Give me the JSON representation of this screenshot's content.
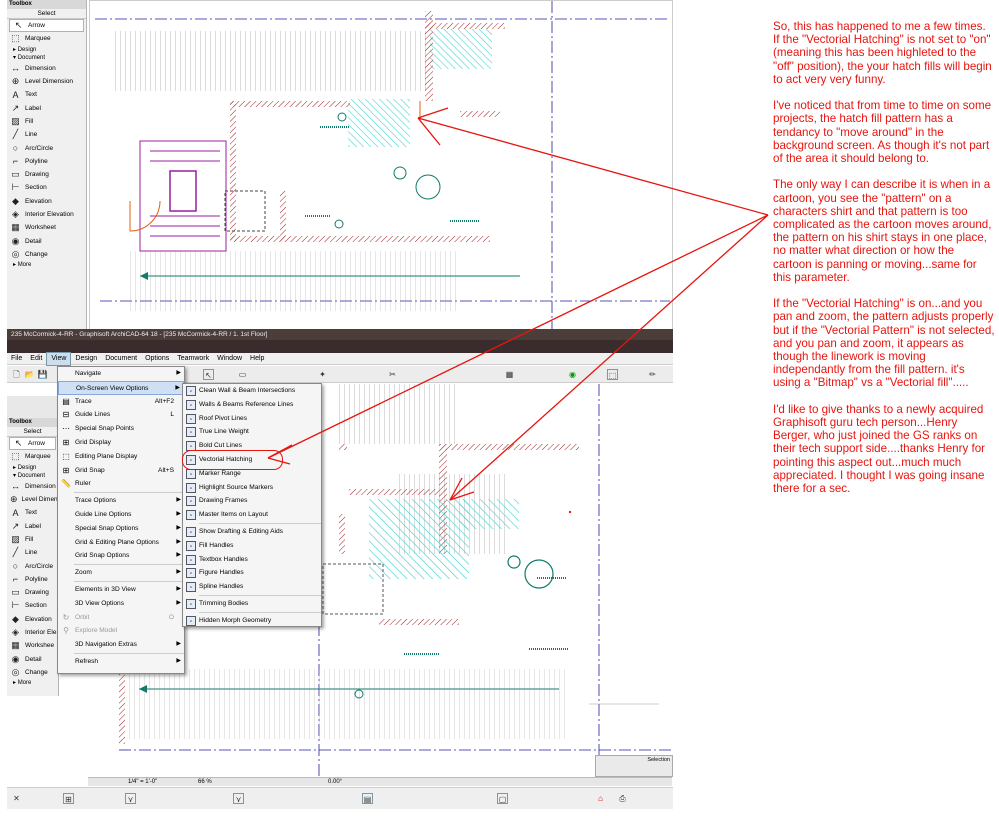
{
  "top_toolbox": {
    "title": "Toolbox",
    "select_label": "Select",
    "items": [
      {
        "icon": "arrow-icon",
        "glyph": "↖",
        "label": "Arrow"
      },
      {
        "icon": "marquee-icon",
        "glyph": "⬚",
        "label": "Marquee"
      }
    ],
    "design_label": "Design",
    "document_label": "Document",
    "doc_items": [
      {
        "icon": "dimension-icon",
        "glyph": "↔",
        "label": "Dimension"
      },
      {
        "icon": "level-dimension-icon",
        "glyph": "⊕",
        "label": "Level Dimension"
      },
      {
        "icon": "text-icon",
        "glyph": "A",
        "label": "Text"
      },
      {
        "icon": "label-icon",
        "glyph": "↗",
        "label": "Label"
      },
      {
        "icon": "fill-icon",
        "glyph": "▨",
        "label": "Fill"
      },
      {
        "icon": "line-icon",
        "glyph": "╱",
        "label": "Line"
      },
      {
        "icon": "arc-circle-icon",
        "glyph": "○",
        "label": "Arc/Circle"
      },
      {
        "icon": "polyline-icon",
        "glyph": "⌐",
        "label": "Polyline"
      },
      {
        "icon": "drawing-icon",
        "glyph": "▭",
        "label": "Drawing"
      },
      {
        "icon": "section-icon",
        "glyph": "⊢",
        "label": "Section"
      },
      {
        "icon": "elevation-icon",
        "glyph": "◆",
        "label": "Elevation"
      },
      {
        "icon": "interior-elevation-icon",
        "glyph": "◈",
        "label": "Interior Elevation"
      },
      {
        "icon": "worksheet-icon",
        "glyph": "▦",
        "label": "Worksheet"
      },
      {
        "icon": "detail-icon",
        "glyph": "◉",
        "label": "Detail"
      },
      {
        "icon": "change-icon",
        "glyph": "◎",
        "label": "Change"
      }
    ],
    "more_label": "More"
  },
  "bottom_toolbox": {
    "title": "Toolbox",
    "select_label": "Select",
    "items": [
      {
        "icon": "arrow-icon",
        "glyph": "↖",
        "label": "Arrow"
      },
      {
        "icon": "marquee-icon",
        "glyph": "⬚",
        "label": "Marquee"
      }
    ],
    "design_label": "Design",
    "document_label": "Document",
    "doc_items": [
      {
        "icon": "dimension-icon",
        "glyph": "↔",
        "label": "Dimension"
      },
      {
        "icon": "level-dimension-icon",
        "glyph": "⊕",
        "label": "Level Dimension"
      },
      {
        "icon": "text-icon",
        "glyph": "A",
        "label": "Text"
      },
      {
        "icon": "label-icon",
        "glyph": "↗",
        "label": "Label"
      },
      {
        "icon": "fill-icon",
        "glyph": "▨",
        "label": "Fill"
      },
      {
        "icon": "line-icon",
        "glyph": "╱",
        "label": "Line"
      },
      {
        "icon": "arc-circle-icon",
        "glyph": "○",
        "label": "Arc/Circle"
      },
      {
        "icon": "polyline-icon",
        "glyph": "⌐",
        "label": "Polyline"
      },
      {
        "icon": "drawing-icon",
        "glyph": "▭",
        "label": "Drawing"
      },
      {
        "icon": "section-icon",
        "glyph": "⊢",
        "label": "Section"
      },
      {
        "icon": "elevation-icon",
        "glyph": "◆",
        "label": "Elevation"
      },
      {
        "icon": "interior-elevation-icon",
        "glyph": "◈",
        "label": "Interior Ele"
      },
      {
        "icon": "worksheet-icon",
        "glyph": "▦",
        "label": "Workshee"
      },
      {
        "icon": "detail-icon",
        "glyph": "◉",
        "label": "Detail"
      },
      {
        "icon": "change-icon",
        "glyph": "◎",
        "label": "Change"
      }
    ],
    "more_label": "More"
  },
  "window": {
    "title": "235 McCormick-4-RR - Graphisoft ArchiCAD-64 18 - [235 McCormick-4-RR / 1. 1st Floor]",
    "menus": [
      "File",
      "Edit",
      "View",
      "Design",
      "Document",
      "Options",
      "Teamwork",
      "Window",
      "Help"
    ],
    "open_menu": "View"
  },
  "view_menu": [
    {
      "label": "Navigate",
      "icon": "",
      "shortcut": "",
      "arrow": true
    },
    {
      "label": "On-Screen View Options",
      "icon": "",
      "shortcut": "",
      "arrow": true,
      "selected": true
    },
    {
      "label": "Trace",
      "icon": "trace-icon",
      "shortcut": "Alt+F2",
      "arrow": false
    },
    {
      "label": "Guide Lines",
      "icon": "guide-lines-icon",
      "shortcut": "L",
      "arrow": false
    },
    {
      "label": "Special Snap Points",
      "icon": "snap-points-icon",
      "shortcut": "",
      "arrow": false
    },
    {
      "label": "Grid Display",
      "icon": "grid-display-icon",
      "shortcut": "",
      "arrow": false
    },
    {
      "label": "Editing Plane Display",
      "icon": "editing-plane-icon",
      "shortcut": "",
      "arrow": false
    },
    {
      "label": "Grid Snap",
      "icon": "grid-snap-icon",
      "shortcut": "Alt+S",
      "arrow": false
    },
    {
      "label": "Ruler",
      "icon": "ruler-icon",
      "shortcut": "",
      "arrow": false
    },
    {
      "sep": true
    },
    {
      "label": "Trace Options",
      "icon": "",
      "shortcut": "",
      "arrow": true
    },
    {
      "label": "Guide Line Options",
      "icon": "",
      "shortcut": "",
      "arrow": true
    },
    {
      "label": "Special Snap Options",
      "icon": "",
      "shortcut": "",
      "arrow": true
    },
    {
      "label": "Grid & Editing Plane Options",
      "icon": "",
      "shortcut": "",
      "arrow": true
    },
    {
      "label": "Grid Snap Options",
      "icon": "",
      "shortcut": "",
      "arrow": true
    },
    {
      "sep": true
    },
    {
      "label": "Zoom",
      "icon": "",
      "shortcut": "",
      "arrow": true
    },
    {
      "sep": true
    },
    {
      "label": "Elements in 3D View",
      "icon": "",
      "shortcut": "",
      "arrow": true
    },
    {
      "label": "3D View Options",
      "icon": "",
      "shortcut": "",
      "arrow": true
    },
    {
      "label": "Orbit",
      "icon": "orbit-icon",
      "shortcut": "O",
      "arrow": false,
      "disabled": true
    },
    {
      "label": "Explore Model",
      "icon": "explore-model-icon",
      "shortcut": "",
      "arrow": false,
      "disabled": true
    },
    {
      "label": "3D Navigation Extras",
      "icon": "",
      "shortcut": "",
      "arrow": true
    },
    {
      "sep": true
    },
    {
      "label": "Refresh",
      "icon": "",
      "shortcut": "",
      "arrow": true
    }
  ],
  "submenu": [
    {
      "label": "Clean Wall & Beam Intersections"
    },
    {
      "label": "Walls & Beams Reference Lines"
    },
    {
      "label": "Roof Pivot Lines"
    },
    {
      "label": "True Line Weight"
    },
    {
      "label": "Bold Cut Lines"
    },
    {
      "label": "Vectorial Hatching",
      "circled": true
    },
    {
      "label": "Marker Range"
    },
    {
      "label": "Highlight Source Markers"
    },
    {
      "label": "Drawing Frames"
    },
    {
      "label": "Master Items on Layout"
    },
    {
      "sep": true
    },
    {
      "label": "Show Drafting & Editing Aids"
    },
    {
      "label": "Fill Handles"
    },
    {
      "label": "Textbox Handles"
    },
    {
      "label": "Figure Handles"
    },
    {
      "label": "Spline Handles"
    },
    {
      "sep": true
    },
    {
      "label": "Trimming Bodies"
    },
    {
      "sep": true
    },
    {
      "label": "Hidden Morph Geometry"
    }
  ],
  "status": {
    "scale": "1/4\" = 1'-0\"",
    "zoom": "66 %",
    "angle": "0.00°",
    "selection": "Selection"
  },
  "annotation": [
    "So, this has happened to me a few times. If the \"Vectorial Hatching\" is not set to \"on\" (meaning this has been highleted to the \"off\" position), the your hatch fills will begin to act very very funny.",
    "I've noticed that from time to time on some projects, the hatch fill pattern has a tendancy to \"move around\" in the background screen. As though it's not part of the area it should belong to.",
    "The only way I can describe it is when in a cartoon, you see the \"pattern\" on a characters shirt and that pattern is too complicated as the cartoon moves around, the pattern on his shirt stays in one place, no matter what direction or how the cartoon is panning or moving...same for this parameter.",
    "If the \"Vectorial Hatching\" is on...and you pan and zoom, the pattern adjusts properly but if the \"Vectorial Pattern\" is not selected, and you pan and zoom, it appears as though the linework is moving independantly from the fill pattern. it's using a \"Bitmap\" vs a \"Vectorial fill\".....",
    "I'd like to give thanks to a newly acquired Graphisoft guru tech person...Henry Berger, who just joined the GS ranks on their tech support side....thanks Henry for pointing this aspect out...much much appreciated. I thought I was going insane there for a sec."
  ],
  "colors": {
    "annotation": "#e8140e",
    "hatch": "#46d3d3",
    "wall_hatch": "#a02020",
    "stair": "#9b1fa0",
    "section_line": "#2020a0",
    "door": "#e06010",
    "accent_teal": "#0f7a6a"
  }
}
